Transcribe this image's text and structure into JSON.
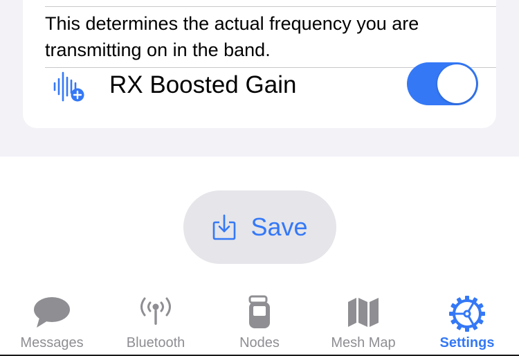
{
  "lora": {
    "description": "This determines the actual frequency you are transmitting on in the band.",
    "rx_boosted_gain": {
      "label": "RX Boosted Gain",
      "icon": "waveform-plus-icon",
      "enabled": true
    }
  },
  "save_button": {
    "label": "Save",
    "icon": "square-arrow-down-icon"
  },
  "tabbar": {
    "items": [
      {
        "label": "Messages",
        "icon": "chat-bubble-icon",
        "active": false
      },
      {
        "label": "Bluetooth",
        "icon": "antenna-radiowaves-icon",
        "active": false
      },
      {
        "label": "Nodes",
        "icon": "flipphone-icon",
        "active": false
      },
      {
        "label": "Mesh Map",
        "icon": "map-icon",
        "active": false
      },
      {
        "label": "Settings",
        "icon": "gear-icon",
        "active": true
      }
    ]
  },
  "colors": {
    "accent": "#3478f6",
    "inactive": "#8e8e93",
    "background": "#f2f2f7"
  }
}
